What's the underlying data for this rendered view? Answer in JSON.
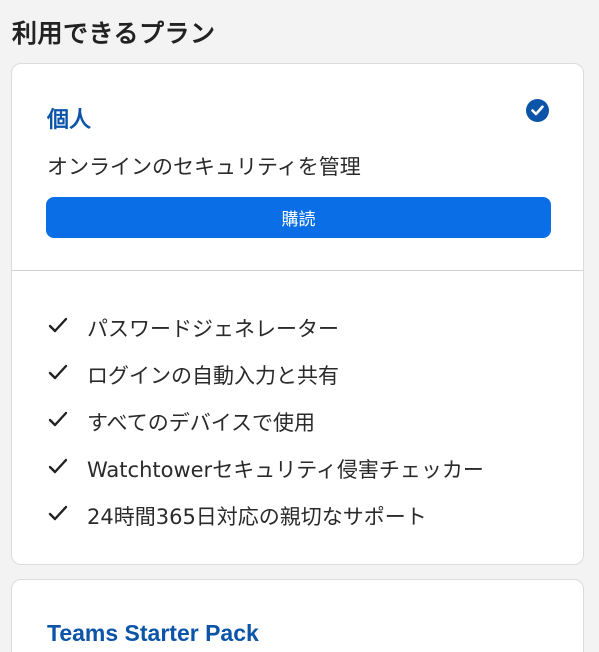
{
  "section_title": "利用できるプラン",
  "plans": [
    {
      "name": "個人",
      "selected_icon": "check-circle-icon",
      "description": "オンラインのセキュリティを管理",
      "button_label": "購読",
      "features": [
        "パスワードジェネレーター",
        "ログインの自動入力と共有",
        "すべてのデバイスで使用",
        "Watchtowerセキュリティ侵害チェッカー",
        "24時間365日対応の親切なサポート"
      ]
    },
    {
      "name": "Teams Starter Pack"
    }
  ],
  "colors": {
    "accent": "#0b54a8",
    "button": "#0a6fe6",
    "background": "#f3f3f4"
  }
}
